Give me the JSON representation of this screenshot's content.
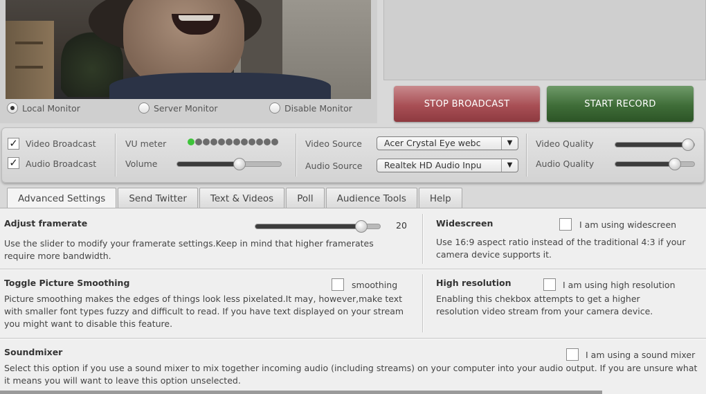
{
  "monitor": {
    "options": [
      {
        "label": "Local Monitor",
        "selected": true
      },
      {
        "label": "Server Monitor",
        "selected": false
      },
      {
        "label": "Disable Monitor",
        "selected": false
      }
    ]
  },
  "actions": {
    "stop_broadcast": "STOP BROADCAST",
    "start_record": "START RECORD",
    "stop_color": "#a84f55",
    "record_color": "#3f6d38"
  },
  "controls": {
    "video_broadcast": {
      "label": "Video Broadcast",
      "checked": true
    },
    "audio_broadcast": {
      "label": "Audio Broadcast",
      "checked": true
    },
    "vu_meter": {
      "label": "VU meter",
      "lit_dots": 1,
      "total_dots": 12
    },
    "volume": {
      "label": "Volume",
      "level": 0.6
    },
    "video_source": {
      "label": "Video Source",
      "value": "Acer Crystal Eye webc"
    },
    "audio_source": {
      "label": "Audio Source",
      "value": "Realtek HD Audio Inpu"
    },
    "video_quality": {
      "label": "Video Quality",
      "level": 0.92
    },
    "audio_quality": {
      "label": "Audio Quality",
      "level": 0.75
    }
  },
  "tabs": [
    "Advanced Settings",
    "Send Twitter",
    "Text & Videos",
    "Poll",
    "Audience Tools",
    "Help"
  ],
  "active_tab": 0,
  "settings": {
    "framerate": {
      "title": "Adjust framerate",
      "value": "20",
      "level": 0.85,
      "desc": "Use the slider to modify your framerate settings.Keep in mind that higher framerates require more bandwidth."
    },
    "widescreen": {
      "title": "Widescreen",
      "option": "I am using widescreen",
      "desc": "Use 16:9 aspect ratio instead of the traditional 4:3 if your camera device supports it."
    },
    "smoothing": {
      "title": "Toggle Picture Smoothing",
      "option": "smoothing",
      "desc": "Picture smoothing makes the edges of things look less pixelated.It may, however,make text with smaller font types fuzzy and difficult to read. If you have text displayed on your stream you might want to disable this feature."
    },
    "high_res": {
      "title": "High resolution",
      "option": "I am using high resolution",
      "desc": "Enabling this chekbox attempts to get a higher resolution video stream from your camera device."
    },
    "soundmixer": {
      "title": "Soundmixer",
      "option": "I am using a sound mixer",
      "desc": "Select this option if you use a sound mixer to mix together incoming audio (including streams) on your computer into your audio output. If you are unsure what it means you will want to leave this option unselected."
    }
  }
}
